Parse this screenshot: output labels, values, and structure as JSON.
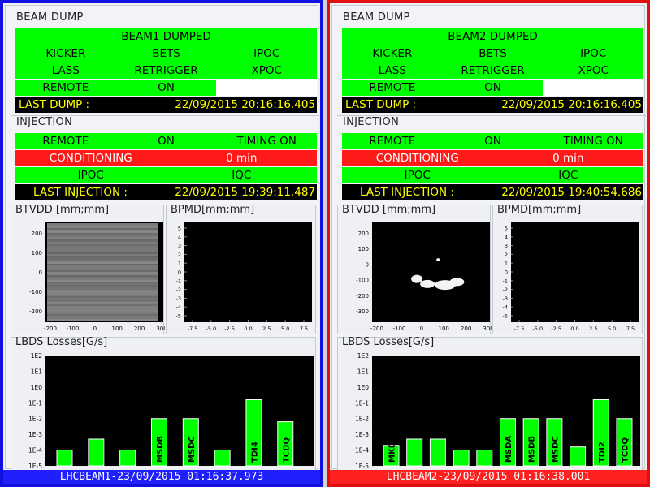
{
  "beams": [
    {
      "beam_dump": {
        "title": "BEAM DUMP",
        "status": "BEAM1 DUMPED",
        "row2": [
          "KICKER",
          "BETS",
          "IPOC"
        ],
        "row3": [
          "LASS",
          "RETRIGGER",
          "XPOC"
        ],
        "row4": [
          "REMOTE",
          "ON"
        ],
        "last_dump_label": "LAST DUMP :",
        "last_dump_value": "22/09/2015 20:16:16.405"
      },
      "injection": {
        "title": "INJECTION",
        "row1": [
          "REMOTE",
          "ON",
          "TIMING ON"
        ],
        "row2": [
          "CONDITIONING",
          "0 min"
        ],
        "row3": [
          "IPOC",
          "IQC"
        ],
        "last_label": "LAST INJECTION :",
        "last_value": "22/09/2015 19:39:11.487"
      },
      "btvdd": {
        "title": "BTVDD [mm;mm]",
        "yticks": [
          "200",
          "100",
          "0",
          "-100",
          "-200"
        ],
        "xticks": [
          "-200",
          "-100",
          "0",
          "100",
          "200",
          "300"
        ],
        "image": "noise"
      },
      "bpmd": {
        "title": "BPMD[mm;mm]",
        "yticks": [
          "5",
          "4",
          "3",
          "2",
          "1",
          "0",
          "-1",
          "-2",
          "-3",
          "-4",
          "-5"
        ],
        "xticks": [
          "-7.5",
          "-5.0",
          "-2.5",
          "0.0",
          "2.5",
          "5.0",
          "7.5"
        ]
      },
      "losses": {
        "title": "LBDS Losses[G/s]",
        "yticks": [
          "1E2",
          "1E1",
          "1E0",
          "1E-1",
          "1E-2",
          "1E-3",
          "1E-4",
          "1E-5"
        ],
        "bars": [
          {
            "exp": -4,
            "label": ""
          },
          {
            "exp": -3.3,
            "label": ""
          },
          {
            "exp": -4,
            "label": ""
          },
          {
            "exp": -2,
            "label": "MSDB"
          },
          {
            "exp": -2,
            "label": "MSDC"
          },
          {
            "exp": -4,
            "label": ""
          },
          {
            "exp": -0.8,
            "label": "TDI4"
          },
          {
            "exp": -2.2,
            "label": "TCDQ"
          }
        ]
      },
      "footer": "LHCBEAM1-23/09/2015 01:16:37.973",
      "color": "#1010e0"
    },
    {
      "beam_dump": {
        "title": "BEAM DUMP",
        "status": "BEAM2 DUMPED",
        "row2": [
          "KICKER",
          "BETS",
          "IPOC"
        ],
        "row3": [
          "LASS",
          "RETRIGGER",
          "XPOC"
        ],
        "row4": [
          "REMOTE",
          "ON"
        ],
        "last_dump_label": "LAST DUMP :",
        "last_dump_value": "22/09/2015 20:16:16.405"
      },
      "injection": {
        "title": "INJECTION",
        "row1": [
          "REMOTE",
          "ON",
          "TIMING ON"
        ],
        "row2": [
          "CONDITIONING",
          "0 min"
        ],
        "row3": [
          "IPOC",
          "IQC"
        ],
        "last_label": "LAST INJECTION :",
        "last_value": "22/09/2015 19:40:54.686"
      },
      "btvdd": {
        "title": "BTVDD [mm;mm]",
        "yticks": [
          "200",
          "100",
          "0",
          "-100",
          "-200",
          "-300"
        ],
        "xticks": [
          "-200",
          "-100",
          "0",
          "100",
          "200",
          "300"
        ],
        "image": "spots"
      },
      "bpmd": {
        "title": "BPMD[mm;mm]",
        "yticks": [
          "5",
          "4",
          "3",
          "2",
          "1",
          "0",
          "-1",
          "-2",
          "-3",
          "-4",
          "-5"
        ],
        "xticks": [
          "-7.5",
          "-5.0",
          "-2.5",
          "0.0",
          "2.5",
          "5.0",
          "7.5"
        ]
      },
      "losses": {
        "title": "LBDS Losses[G/s]",
        "yticks": [
          "1E2",
          "1E1",
          "1E0",
          "1E-1",
          "1E-2",
          "1E-3",
          "1E-4",
          "1E-5"
        ],
        "bars": [
          {
            "exp": -3.7,
            "label": "MKD"
          },
          {
            "exp": -3.3,
            "label": ""
          },
          {
            "exp": -3.3,
            "label": ""
          },
          {
            "exp": -4,
            "label": ""
          },
          {
            "exp": -4,
            "label": ""
          },
          {
            "exp": -2,
            "label": "MSDA"
          },
          {
            "exp": -2,
            "label": "MSDB"
          },
          {
            "exp": -2,
            "label": "MSDC"
          },
          {
            "exp": -3.8,
            "label": ""
          },
          {
            "exp": -0.8,
            "label": "TDI2"
          },
          {
            "exp": -2,
            "label": "TCDQ"
          }
        ]
      },
      "footer": "LHCBEAM2-23/09/2015 01:16:38.001",
      "color": "#e01010"
    }
  ]
}
